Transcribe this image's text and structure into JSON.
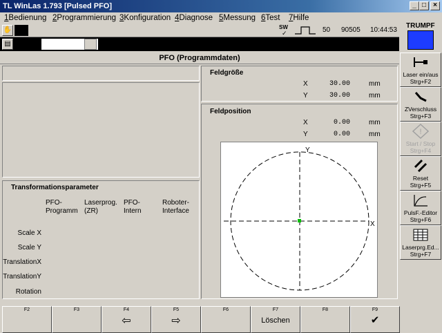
{
  "window": {
    "title": "TL WinLas 1.793 [Pulsed PFO]",
    "min": "_",
    "max": "□",
    "close": "×"
  },
  "menu": [
    {
      "num": "1",
      "label": "Bedienung"
    },
    {
      "num": "2",
      "label": "Programmierung"
    },
    {
      "num": "3",
      "label": "Konfiguration"
    },
    {
      "num": "4",
      "label": "Diagnose"
    },
    {
      "num": "5",
      "label": "Messung"
    },
    {
      "num": "6",
      "label": "Test"
    },
    {
      "num": "7",
      "label": "Hilfe"
    }
  ],
  "status": {
    "sw": "SW",
    "value1": "50",
    "value2": "90505",
    "time": "10:44:53"
  },
  "brand": {
    "name": "TRUMPF",
    "color": "#1d3cff"
  },
  "page_title": "PFO (Programmdaten)",
  "feldgroesse": {
    "title": "Feldgröße",
    "x_label": "X",
    "x_value": "30.00",
    "x_unit": "mm",
    "y_label": "Y",
    "y_value": "30.00",
    "y_unit": "mm"
  },
  "feldposition": {
    "title": "Feldposition",
    "x_label": "X",
    "x_value": "0.00",
    "x_unit": "mm",
    "y_label": "Y",
    "y_value": "0.00",
    "y_unit": "mm",
    "axis_y": "Y",
    "axis_x": "X"
  },
  "transformation": {
    "title": "Transformationsparameter",
    "columns": [
      "PFO-\nProgramm",
      "Laserprog.\n(ZR)",
      "PFO-\nIntern",
      "Roboter-\nInterface"
    ],
    "rows": [
      "Scale X",
      "Scale Y",
      "TranslationX",
      "TranslationY",
      "Rotation"
    ]
  },
  "sidebar": [
    {
      "label": "Laser ein/aus",
      "shortcut": "Strg+F2",
      "icon": "laser-toggle-icon",
      "enabled": true
    },
    {
      "label": "ZVerschluss",
      "shortcut": "Strg+F3",
      "icon": "shutter-icon",
      "enabled": true
    },
    {
      "label": "Start / Stop",
      "shortcut": "Strg+F4",
      "icon": "start-stop-icon",
      "enabled": false
    },
    {
      "label": "Reset",
      "shortcut": "Strg+F5",
      "icon": "reset-icon",
      "enabled": true
    },
    {
      "label": "PulsF.-Editor",
      "shortcut": "Strg+F6",
      "icon": "pulse-editor-icon",
      "enabled": true
    },
    {
      "label": "Laserprg.Ed...",
      "shortcut": "Strg+F7",
      "icon": "table-icon",
      "enabled": true
    }
  ],
  "fkeys": [
    {
      "key": "F2",
      "content": ""
    },
    {
      "key": "F3",
      "content": ""
    },
    {
      "key": "F4",
      "content": "⇦"
    },
    {
      "key": "F5",
      "content": "⇨"
    },
    {
      "key": "F6",
      "content": ""
    },
    {
      "key": "F7",
      "content": "Löschen"
    },
    {
      "key": "F8",
      "content": ""
    },
    {
      "key": "F9",
      "content": "✔"
    }
  ]
}
